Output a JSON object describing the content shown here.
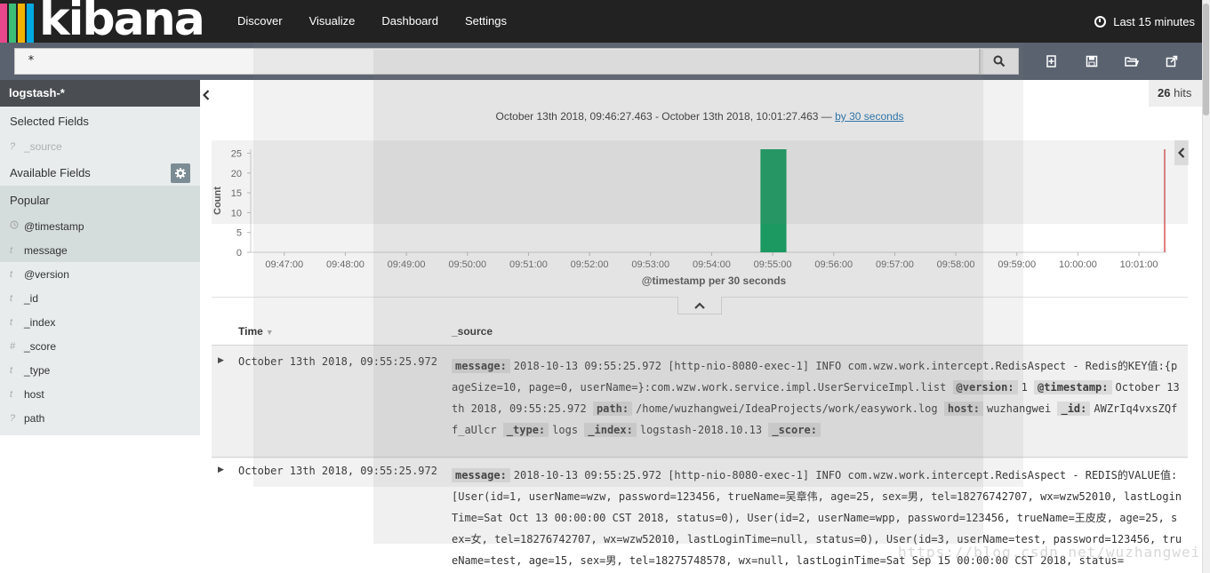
{
  "app": {
    "logo_text": "kibana",
    "brand_stripes": [
      "#e8488b",
      "#3cbe78",
      "#f0b400",
      "#00a9e0"
    ]
  },
  "nav": {
    "items": [
      "Discover",
      "Visualize",
      "Dashboard",
      "Settings"
    ],
    "timepicker": "Last 15 minutes"
  },
  "search": {
    "query": "*"
  },
  "toolbar_icons": [
    "new-search-icon",
    "save-search-icon",
    "open-search-icon",
    "share-icon"
  ],
  "sidebar": {
    "index_pattern": "logstash-*",
    "selected_title": "Selected Fields",
    "selected_fields": [
      {
        "type": "?",
        "name": "_source"
      }
    ],
    "available_title": "Available Fields",
    "popular_title": "Popular",
    "popular_fields": [
      {
        "type": "clock",
        "name": "@timestamp"
      },
      {
        "type": "t",
        "name": "message"
      }
    ],
    "other_fields": [
      {
        "type": "t",
        "name": "@version"
      },
      {
        "type": "t",
        "name": "_id"
      },
      {
        "type": "t",
        "name": "_index"
      },
      {
        "type": "#",
        "name": "_score"
      },
      {
        "type": "t",
        "name": "_type"
      },
      {
        "type": "t",
        "name": "host"
      },
      {
        "type": "?",
        "name": "path"
      }
    ]
  },
  "hits": {
    "count": "26",
    "label": "hits"
  },
  "time_range": {
    "text": "October 13th 2018, 09:46:27.463 - October 13th 2018, 10:01:27.463 —",
    "interval_link": "by 30 seconds"
  },
  "chart_data": {
    "type": "bar",
    "ylabel": "Count",
    "xlabel": "@timestamp per 30 seconds",
    "ylim": [
      0,
      26
    ],
    "y_ticks": [
      0,
      5,
      10,
      15,
      20,
      25
    ],
    "x_ticks": [
      "09:47:00",
      "09:48:00",
      "09:49:00",
      "09:50:00",
      "09:51:00",
      "09:52:00",
      "09:53:00",
      "09:54:00",
      "09:55:00",
      "09:56:00",
      "09:57:00",
      "09:58:00",
      "09:59:00",
      "10:00:00",
      "10:01:00"
    ],
    "x_range": [
      "09:46:27",
      "10:01:27"
    ],
    "bars": [
      {
        "x": "09:55:00",
        "value": 26
      }
    ],
    "bar_color": "#00a05a",
    "now_marker": "10:01:27",
    "now_marker_color": "#e08080"
  },
  "table": {
    "col_time": "Time",
    "col_source": "_source",
    "rows": [
      {
        "time": "October 13th 2018, 09:55:25.972",
        "fields": [
          {
            "k": "message:",
            "v": "2018-10-13 09:55:25.972 [http-nio-8080-exec-1] INFO com.wzw.work.intercept.RedisAspect - Redis的KEY值:{pageSize=10, page=0, userName=}:com.wzw.work.service.impl.UserServiceImpl.list"
          },
          {
            "k": "@version:",
            "v": "1"
          },
          {
            "k": "@timestamp:",
            "v": "October 13th 2018, 09:55:25.972"
          },
          {
            "k": "path:",
            "v": "/home/wuzhangwei/IdeaProjects/work/easywork.log"
          },
          {
            "k": "host:",
            "v": "wuzhangwei"
          },
          {
            "k": "_id:",
            "v": "AWZrIq4vxsZQff_aUlcr"
          },
          {
            "k": "_type:",
            "v": "logs"
          },
          {
            "k": "_index:",
            "v": "logstash-2018.10.13"
          },
          {
            "k": "_score:",
            "v": ""
          }
        ]
      },
      {
        "time": "October 13th 2018, 09:55:25.972",
        "fields": [
          {
            "k": "message:",
            "v": "2018-10-13 09:55:25.972 [http-nio-8080-exec-1] INFO com.wzw.work.intercept.RedisAspect - REDIS的VALUE值:[User(id=1, userName=wzw, password=123456, trueName=吴章伟, age=25, sex=男, tel=18276742707, wx=wzw52010, lastLoginTime=Sat Oct 13 00:00:00 CST 2018, status=0), User(id=2, userName=wpp, password=123456, trueName=王皮皮, age=25, sex=女, tel=18276742707, wx=wzw52010, lastLoginTime=null, status=0), User(id=3, userName=test, password=123456, trueName=test, age=15, sex=男, tel=18275748578, wx=null, lastLoginTime=Sat Sep 15 00:00:00 CST 2018, status="
          }
        ]
      }
    ]
  },
  "watermark": "https://blog.csdn.net/wuzhangweiss"
}
